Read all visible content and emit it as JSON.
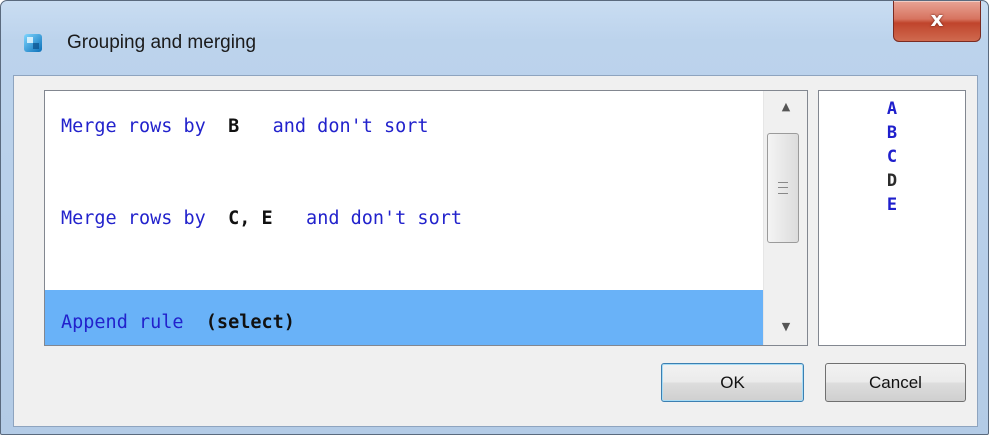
{
  "window": {
    "title": "Grouping and merging",
    "close_label": "x"
  },
  "rules": [
    {
      "prefix": "Merge rows by  ",
      "keys": "B",
      "suffix": "   and don't sort"
    },
    {
      "prefix": "Merge rows by  ",
      "keys": "C, E",
      "suffix": "   and don't sort"
    },
    {
      "prefix": "Append rule  ",
      "keys": "(select)",
      "suffix": ""
    }
  ],
  "columns": [
    "A",
    "B",
    "C",
    "D",
    "E"
  ],
  "buttons": {
    "ok": "OK",
    "cancel": "Cancel"
  }
}
